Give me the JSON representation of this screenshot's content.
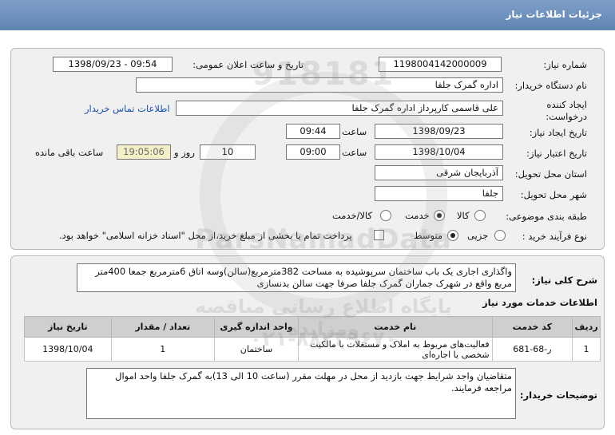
{
  "header": {
    "title": "جزئیات اطلاعات نیاز"
  },
  "watermark": {
    "number": "918181",
    "site": "ParsNamadData",
    "fa_text": "پایگاه اطلاع رسانی مناقصه ومزایده",
    "phone": "۰۲۱-۸۸۳۴۹۶۷۰"
  },
  "form": {
    "need_number_label": "شماره نیاز:",
    "need_number": "1198004142000009",
    "announce_label": "تاریخ و ساعت اعلان عمومی:",
    "announce_value": "1398/09/23 - 09:54",
    "buyer_org_label": "نام دستگاه خریدار:",
    "buyer_org": "اداره گمرک جلفا",
    "creator_label": "ایجاد کننده درخواست:",
    "creator": "علی  قاسمی کارپرداز اداره گمرک جلفا",
    "contact_link": "اطلاعات تماس خریدار",
    "create_date_label": "تاریخ ایجاد نیاز:",
    "create_date": "1398/09/23",
    "time_label": "ساعت",
    "create_time": "09:44",
    "validity_label": "تاریخ اعتبار نیاز:",
    "validity_date": "1398/10/04",
    "validity_time": "09:00",
    "days_value": "10",
    "days_label": "روز و",
    "remaining_time": "19:05:06",
    "remaining_label": "ساعت باقی مانده",
    "province_label": "استان محل تحویل:",
    "province": "آذربایجان شرقی",
    "city_label": "شهر محل تحویل:",
    "city": "جلفا",
    "category_label": "طبقه بندی موضوعی:",
    "category_options": [
      "کالا",
      "خدمت",
      "کالا/خدمت"
    ],
    "category_selected": "خدمت",
    "process_label": "نوع فرآیند خرید :",
    "process_options": [
      "جزیی",
      "متوسط"
    ],
    "process_selected": "متوسط",
    "payment_note": "پرداخت تمام یا بخشی از مبلغ خرید،از محل \"اسناد خزانه اسلامی\" خواهد بود."
  },
  "details": {
    "summary_label": "شرح کلی نیاز:",
    "summary": "واگذاری اجاری یک باب ساختمان سرپوشیده به مساحت 382مترمربع(سالن)وسه اتاق 6مترمربع جمعا 400متر مربع واقع در شهرک جماران گمرک جلفا صرفا جهت سالن بدنسازی",
    "services_title": "اطلاعات خدمات مورد نیاز",
    "table": {
      "headers": [
        "ردیف",
        "کد خدمت",
        "نام خدمت",
        "واحد اندازه گیری",
        "تعداد / مقدار",
        "تاریخ نیاز"
      ],
      "rows": [
        [
          "1",
          "ر-68-681",
          "فعالیت‌های مربوط به املاک و مستغلات با مالکیت شخصی یا اجاره‌ای",
          "ساختمان",
          "1",
          "1398/10/04"
        ]
      ]
    },
    "buyer_notes_label": "توضیحات خریدار:",
    "buyer_notes": "متقاضیان واجد شرایط جهت بازدید از محل در مهلت مقرر (ساعت 10 الی 13)به گمرک جلفا واحد اموال مراجعه فرمایند."
  }
}
